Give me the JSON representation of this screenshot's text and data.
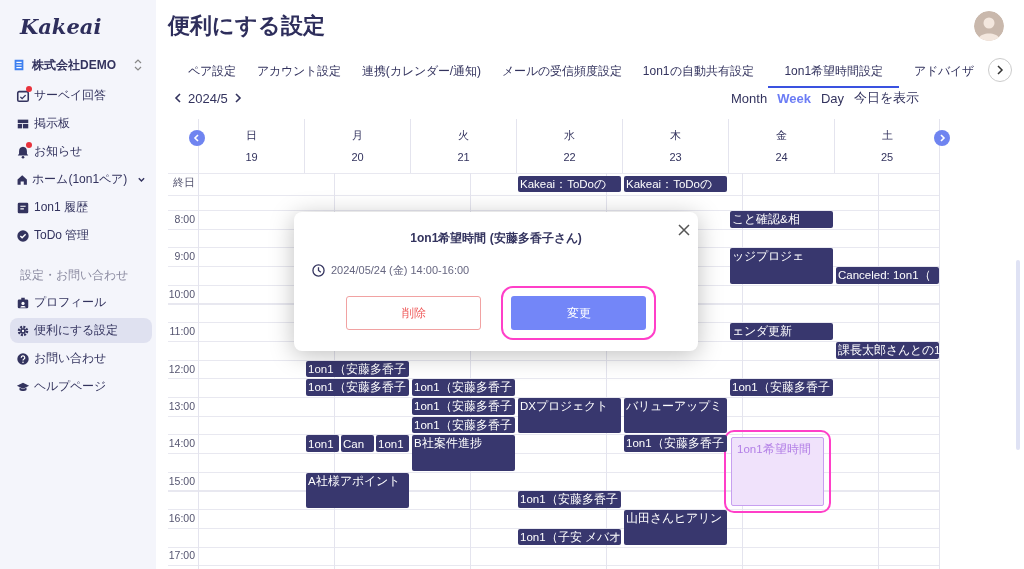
{
  "sidebar": {
    "logo": "Kakeai",
    "company": "株式会社DEMO",
    "items": [
      {
        "label": "サーベイ回答",
        "badge": true,
        "selected": false
      },
      {
        "label": "掲示板",
        "badge": false,
        "selected": false
      },
      {
        "label": "お知らせ",
        "badge": true,
        "selected": false
      },
      {
        "label": "ホーム(1on1ペア)",
        "badge": false,
        "selected": false,
        "expanded": false
      },
      {
        "label": "1on1 履歴",
        "badge": false,
        "selected": false
      },
      {
        "label": "ToDo 管理",
        "badge": false,
        "selected": false
      }
    ],
    "section": "設定・お問い合わせ",
    "items2": [
      {
        "label": "プロフィール",
        "badge": false,
        "selected": false
      },
      {
        "label": "便利にする設定",
        "badge": false,
        "selected": true
      },
      {
        "label": "お問い合わせ",
        "badge": false,
        "selected": false
      },
      {
        "label": "ヘルプページ",
        "badge": false,
        "selected": false
      }
    ]
  },
  "page_title": "便利にする設定",
  "tabs": [
    {
      "label": "ペア設定",
      "selected": false
    },
    {
      "label": "アカウント設定",
      "selected": false
    },
    {
      "label": "連携(カレンダー/通知)",
      "selected": false
    },
    {
      "label": "メールの受信頻度設定",
      "selected": false
    },
    {
      "label": "1on1の自動共有設定",
      "selected": false
    },
    {
      "label": "1on1希望時間設定",
      "selected": true
    },
    {
      "label": "アドバイザ",
      "selected": false
    }
  ],
  "calendar": {
    "month": "2024/5",
    "views": [
      {
        "label": "Month",
        "selected": false
      },
      {
        "label": "Week",
        "selected": true
      },
      {
        "label": "Day",
        "selected": false
      }
    ],
    "today": "今日を表示",
    "days": [
      {
        "name": "日",
        "date": "19"
      },
      {
        "name": "月",
        "date": "20"
      },
      {
        "name": "火",
        "date": "21"
      },
      {
        "name": "水",
        "date": "22"
      },
      {
        "name": "木",
        "date": "23"
      },
      {
        "name": "金",
        "date": "24"
      },
      {
        "name": "土",
        "date": "25"
      }
    ],
    "all_day_label": "終日",
    "all_day": [
      {
        "title": "Kakeai：ToDoの"
      },
      {
        "title": "Kakeai：ToDoの"
      }
    ],
    "time_labels": [
      "8:00",
      "9:00",
      "10:00",
      "11:00",
      "12:00",
      "13:00",
      "14:00",
      "15:00",
      "16:00",
      "17:00"
    ],
    "events": [
      {
        "kind": "event",
        "title": "こと確認&相"
      },
      {
        "kind": "event",
        "title": "ッジプロジェ"
      },
      {
        "kind": "event",
        "title": "Canceled: 1on1（"
      },
      {
        "kind": "event",
        "title": "ェンダ更新"
      },
      {
        "kind": "event",
        "title": "課長太郎さんとの1"
      },
      {
        "kind": "event",
        "title": "1on1（安藤多香子"
      },
      {
        "kind": "event",
        "title": "1on1（安藤多香子"
      },
      {
        "kind": "event",
        "title": "1on1（安藤多香子"
      },
      {
        "kind": "event",
        "title": "1on1（安藤多香子"
      },
      {
        "kind": "event",
        "title": "1on1（安藤多香子"
      },
      {
        "kind": "event",
        "title": "1on1（安藤多香子"
      },
      {
        "kind": "event",
        "title": "DXプロジェクト"
      },
      {
        "kind": "event",
        "title": "バリューアップミ"
      },
      {
        "kind": "split",
        "parts": [
          "1on1",
          "Can",
          "1on1"
        ]
      },
      {
        "kind": "event",
        "title": "B社案件進捗"
      },
      {
        "kind": "event",
        "title": "1on1（安藤多香子"
      },
      {
        "kind": "request",
        "title": "1on1希望時間",
        "highlighted": true
      },
      {
        "kind": "event",
        "title": "A社様アポイント"
      },
      {
        "kind": "event",
        "title": "1on1（安藤多香子"
      },
      {
        "kind": "event",
        "title": "山田さんヒアリン"
      },
      {
        "kind": "event",
        "title": "1on1（子安 メバオ"
      }
    ]
  },
  "dialog": {
    "title": "1on1希望時間 (安藤多香子さん)",
    "datetime": "2024/05/24 (金) 14:00-16:00",
    "buttons": [
      {
        "kind": "delete",
        "label": "削除",
        "highlighted": false
      },
      {
        "kind": "primary",
        "label": "変更",
        "highlighted": true
      }
    ]
  }
}
